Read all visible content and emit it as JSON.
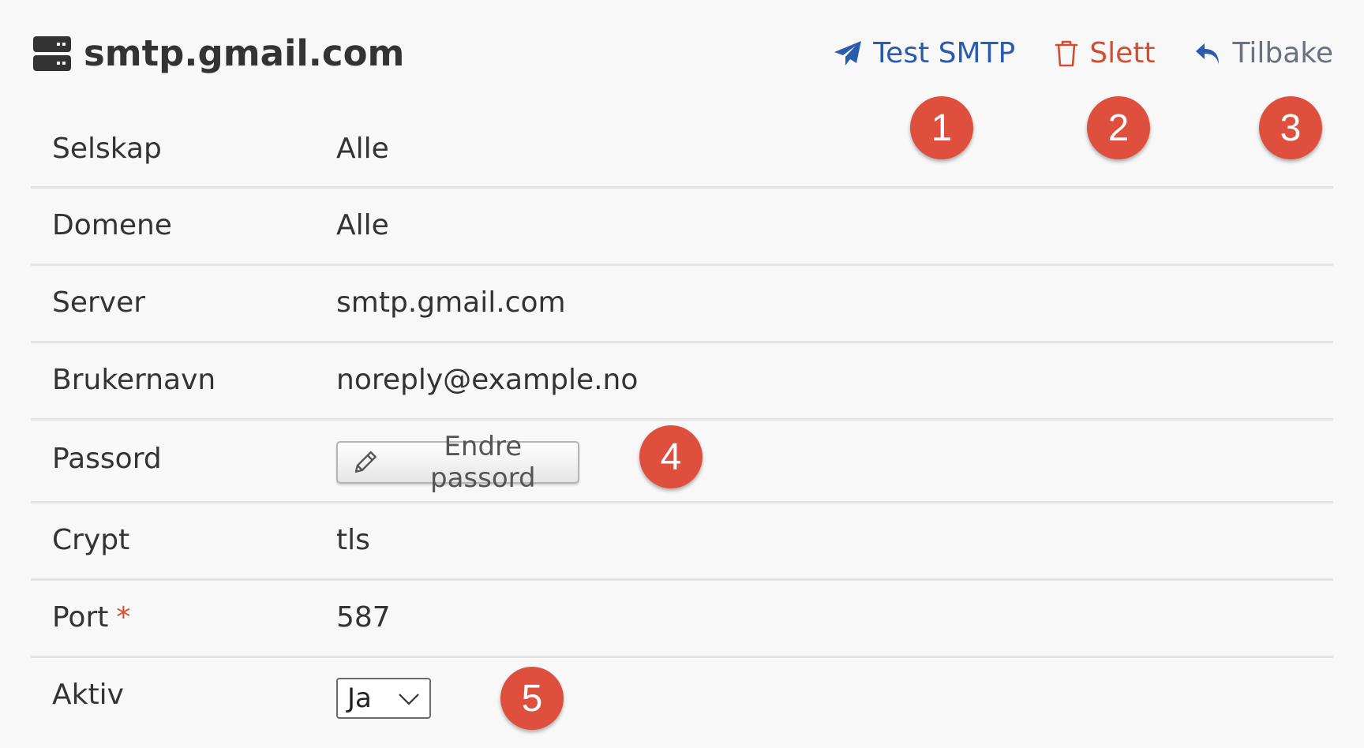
{
  "header": {
    "title": "smtp.gmail.com",
    "title_icon": "server-icon",
    "actions": {
      "test_smtp": {
        "label": "Test SMTP",
        "icon": "paper-plane-icon",
        "color": "#2a5bad"
      },
      "delete": {
        "label": "Slett",
        "icon": "trash-icon",
        "color": "#d14f31"
      },
      "back": {
        "label": "Tilbake",
        "icon": "reply-arrow-icon",
        "color": "#6a7280"
      }
    }
  },
  "fields": {
    "company": {
      "label": "Selskap",
      "value": "Alle"
    },
    "domains": {
      "label": "Domene",
      "value": "Alle"
    },
    "server": {
      "label": "Server",
      "value": "smtp.gmail.com"
    },
    "username": {
      "label": "Brukernavn",
      "value": "noreply@example.no"
    },
    "password": {
      "label": "Passord",
      "button_label": "Endre passord",
      "button_icon": "pencil-icon"
    },
    "crypt": {
      "label": "Crypt",
      "value": "tls"
    },
    "port": {
      "label": "Port",
      "required_mark": "*",
      "value": "587"
    },
    "active": {
      "label": "Aktiv",
      "selected": "Ja"
    }
  },
  "callouts": [
    "1",
    "2",
    "3",
    "4",
    "5"
  ],
  "colors": {
    "callout": "#de4f3d",
    "required": "#d14f31",
    "background": "#f8f8f8",
    "divider": "#e3e3e3"
  }
}
